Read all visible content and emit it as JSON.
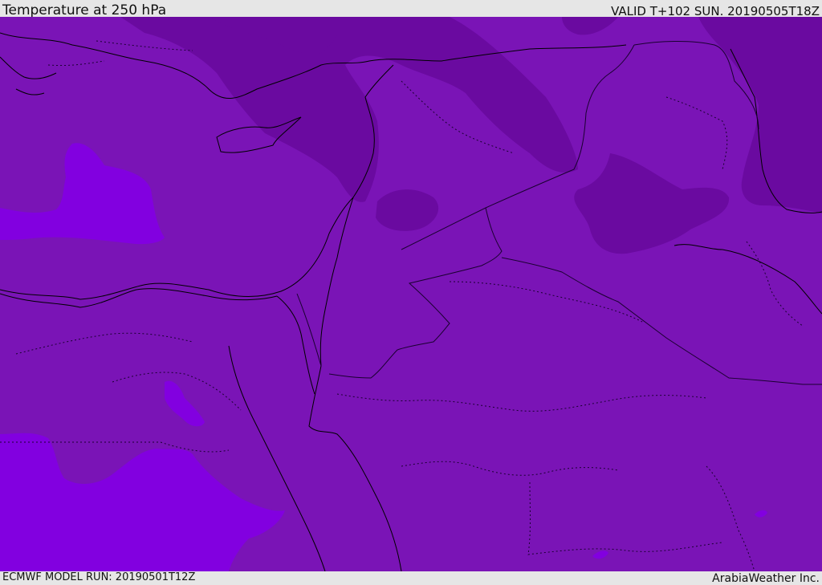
{
  "header": {
    "title": "Temperature at 250 hPa",
    "valid": "VALID T+102 SUN. 20190505T18Z"
  },
  "footer": {
    "model_run": "ECMWF MODEL RUN: 20190501T12Z",
    "credit": "ArabiaWeather Inc."
  },
  "colors": {
    "base_band": "#7a14b6",
    "cold_band": "#6a0aa0",
    "warm_band": "#8200e0",
    "coastline": "#000000",
    "border": "#1a0030"
  }
}
